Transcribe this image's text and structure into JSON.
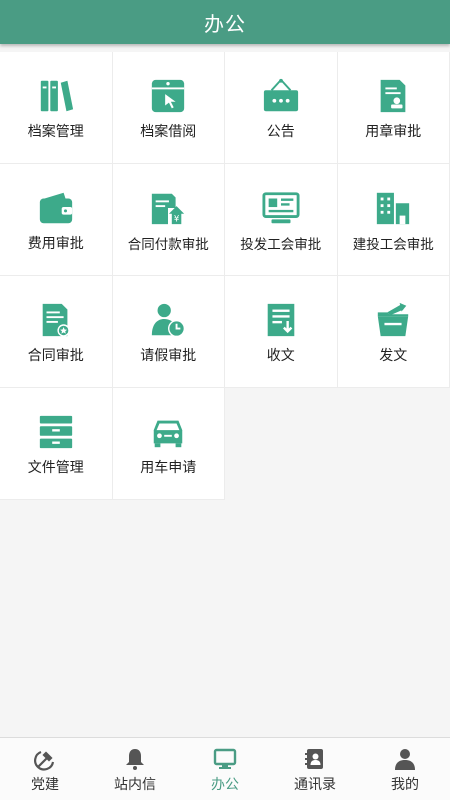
{
  "header": {
    "title": "办公"
  },
  "colors": {
    "accent": "#4a9c84",
    "icon": "#3daa8a",
    "tab_inactive": "#555555"
  },
  "grid": {
    "items": [
      {
        "label": "档案管理",
        "icon": "archive-books-icon"
      },
      {
        "label": "档案借阅",
        "icon": "archive-borrow-icon"
      },
      {
        "label": "公告",
        "icon": "announcement-board-icon"
      },
      {
        "label": "用章审批",
        "icon": "seal-approval-icon"
      },
      {
        "label": "费用审批",
        "icon": "wallet-icon"
      },
      {
        "label": "合同付款审批",
        "icon": "contract-payment-icon"
      },
      {
        "label": "投发工会审批",
        "icon": "union-card-icon"
      },
      {
        "label": "建投工会审批",
        "icon": "buildings-icon"
      },
      {
        "label": "合同审批",
        "icon": "contract-approval-icon"
      },
      {
        "label": "请假审批",
        "icon": "leave-clock-icon"
      },
      {
        "label": "收文",
        "icon": "receive-document-icon"
      },
      {
        "label": "发文",
        "icon": "send-folder-icon"
      },
      {
        "label": "文件管理",
        "icon": "file-cabinet-icon"
      },
      {
        "label": "用车申请",
        "icon": "car-icon"
      }
    ]
  },
  "tabs": [
    {
      "label": "党建",
      "icon": "hammer-sickle-icon"
    },
    {
      "label": "站内信",
      "icon": "bell-icon"
    },
    {
      "label": "办公",
      "icon": "monitor-icon",
      "active": true
    },
    {
      "label": "通讯录",
      "icon": "contacts-book-icon"
    },
    {
      "label": "我的",
      "icon": "user-icon"
    }
  ]
}
